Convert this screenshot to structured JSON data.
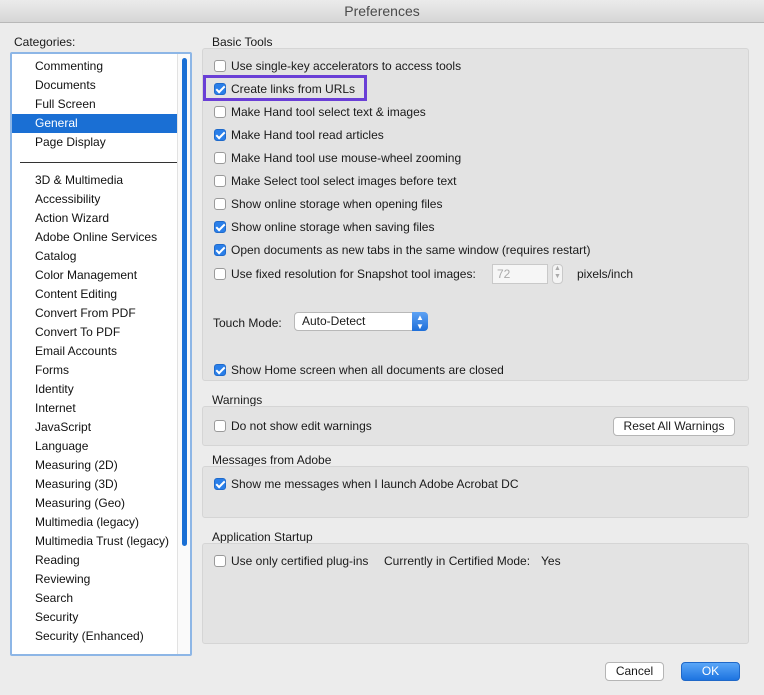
{
  "window": {
    "title": "Preferences"
  },
  "categories": {
    "label": "Categories:",
    "items_top": [
      "Commenting",
      "Documents",
      "Full Screen",
      "General",
      "Page Display"
    ],
    "items_bottom": [
      "3D & Multimedia",
      "Accessibility",
      "Action Wizard",
      "Adobe Online Services",
      "Catalog",
      "Color Management",
      "Content Editing",
      "Convert From PDF",
      "Convert To PDF",
      "Email Accounts",
      "Forms",
      "Identity",
      "Internet",
      "JavaScript",
      "Language",
      "Measuring (2D)",
      "Measuring (3D)",
      "Measuring (Geo)",
      "Multimedia (legacy)",
      "Multimedia Trust (legacy)",
      "Reading",
      "Reviewing",
      "Search",
      "Security",
      "Security (Enhanced)"
    ],
    "selected": "General"
  },
  "basic_tools": {
    "title": "Basic Tools",
    "options": [
      {
        "label": "Use single-key accelerators to access tools",
        "checked": false
      },
      {
        "label": "Create links from URLs",
        "checked": true
      },
      {
        "label": "Make Hand tool select text & images",
        "checked": false
      },
      {
        "label": "Make Hand tool read articles",
        "checked": true
      },
      {
        "label": "Make Hand tool use mouse-wheel zooming",
        "checked": false
      },
      {
        "label": "Make Select tool select images before text",
        "checked": false
      },
      {
        "label": "Show online storage when opening files",
        "checked": false
      },
      {
        "label": "Show online storage when saving files",
        "checked": true
      },
      {
        "label": "Open documents as new tabs in the same window (requires restart)",
        "checked": true
      },
      {
        "label": "Use fixed resolution for Snapshot tool images:",
        "checked": false
      }
    ],
    "snapshot_value": "72",
    "snapshot_unit": "pixels/inch",
    "touch_mode_label": "Touch Mode:",
    "touch_mode_value": "Auto-Detect",
    "home_screen": {
      "label": "Show Home screen when all documents are closed",
      "checked": true
    }
  },
  "warnings": {
    "title": "Warnings",
    "option": {
      "label": "Do not show edit warnings",
      "checked": false
    },
    "reset_button": "Reset All Warnings"
  },
  "messages": {
    "title": "Messages from Adobe",
    "option": {
      "label": "Show me messages when I launch Adobe Acrobat DC",
      "checked": true
    }
  },
  "startup": {
    "title": "Application Startup",
    "option": {
      "label": "Use only certified plug-ins",
      "checked": false
    },
    "mode_label": "Currently in Certified Mode:",
    "mode_value": "Yes"
  },
  "footer": {
    "cancel": "Cancel",
    "ok": "OK"
  }
}
